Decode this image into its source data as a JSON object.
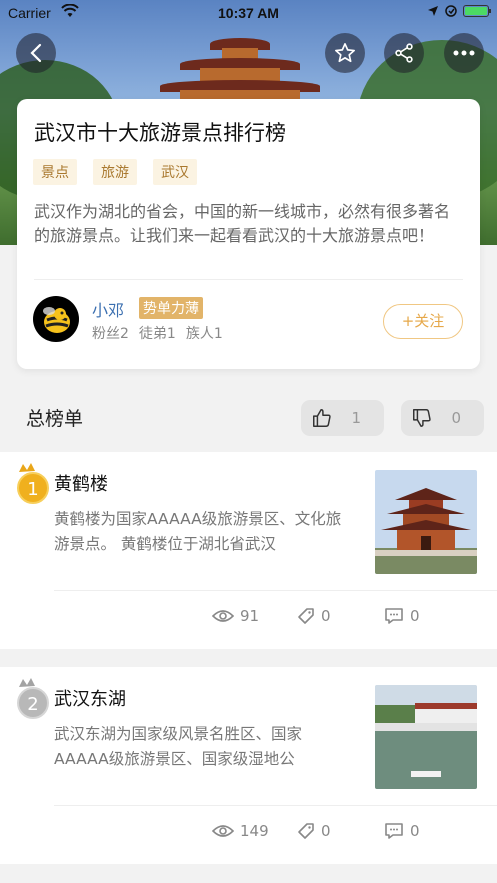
{
  "status_bar": {
    "carrier": "Carrier",
    "time": "10:37 AM"
  },
  "list": {
    "title": "武汉市十大旅游景点排行榜",
    "tags": [
      "景点",
      "旅游",
      "武汉"
    ],
    "description": "武汉作为湖北的省会，中国的新一线城市，必然有很多著名的旅游景点。让我们来一起看看武汉的十大旅游景点吧！"
  },
  "author": {
    "name": "小邓",
    "badge": "势单力薄",
    "stats": [
      "粉丝2",
      "徒弟1",
      "族人1"
    ],
    "follow_label": "+关注"
  },
  "ranking": {
    "title": "总榜单",
    "like_count": "1",
    "dislike_count": "0"
  },
  "items": [
    {
      "rank": "1",
      "name": "黄鹤楼",
      "text": "黄鹤楼为国家AAAAA级旅游景区、文化旅游景点。 黄鹤楼位于湖北省武汉",
      "views": "91",
      "tags": "0",
      "comments": "0",
      "medal_color": "#f0b01e"
    },
    {
      "rank": "2",
      "name": "武汉东湖",
      "text": "武汉东湖为国家级风景名胜区、国家AAAAA级旅游景区、国家级湿地公",
      "views": "149",
      "tags": "0",
      "comments": "0",
      "medal_color": "#b8b8b8"
    }
  ],
  "colors": {
    "accent": "#e6a84a",
    "tag_text": "#a9782e",
    "username": "#3b6fb0"
  }
}
